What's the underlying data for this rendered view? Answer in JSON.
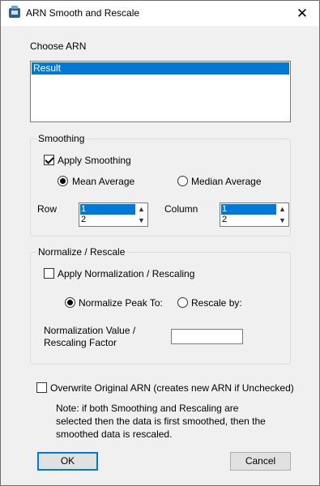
{
  "window": {
    "title": "ARN Smooth and Rescale",
    "close_glyph": "✕"
  },
  "choose_arn": {
    "label": "Choose ARN",
    "items": [
      "Result"
    ],
    "selected": "Result"
  },
  "smoothing": {
    "group_title": "Smoothing",
    "apply_label": "Apply Smoothing",
    "apply_checked": true,
    "mean_label": "Mean Average",
    "median_label": "Median Average",
    "selected_method": "Mean Average",
    "row_label": "Row",
    "row_values": [
      "1",
      "2"
    ],
    "column_label": "Column",
    "column_values": [
      "1",
      "2"
    ]
  },
  "normalize": {
    "group_title": "Normalize / Rescale",
    "apply_label": "Apply Normalization / Rescaling",
    "apply_checked": false,
    "peak_label": "Normalize Peak To:",
    "rescale_label": "Rescale by:",
    "selected_mode": "Normalize Peak To:",
    "value_label_line1": "Normalization Value /",
    "value_label_line2": "Rescaling Factor",
    "value": ""
  },
  "overwrite": {
    "label": "Overwrite Original ARN (creates new ARN if Unchecked)",
    "checked": false
  },
  "note": {
    "line1": "Note: if both Smoothing and Rescaling are",
    "line2": "selected then the data is first smoothed, then the",
    "line3": "smoothed data is rescaled."
  },
  "buttons": {
    "ok": "OK",
    "cancel": "Cancel"
  },
  "icons": {
    "app": "app-window-icon",
    "close": "close-icon",
    "spin_up": "▲",
    "spin_down": "▼"
  },
  "colors": {
    "selection": "#0078d7",
    "default_button_border": "#0078d7"
  }
}
